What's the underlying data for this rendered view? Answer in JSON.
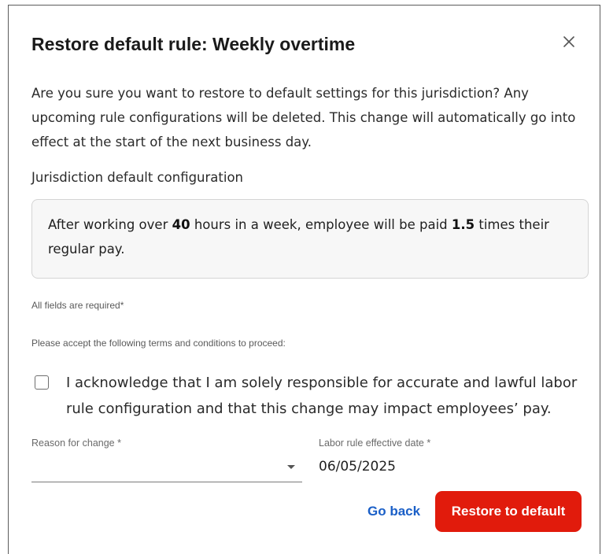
{
  "dialog": {
    "title": "Restore default rule: Weekly overtime",
    "close_icon": "close-icon",
    "intro": "Are you sure you want to restore to default settings for this jurisdiction? Any upcoming rule configurations will be deleted. This change will automatically go into effect at the start of the next business day.",
    "section_label": "Jurisdiction default configuration",
    "config": {
      "text_before_hours": "After working over ",
      "hours": "40",
      "text_after_hours": " hours in a week, employee will be paid ",
      "multiplier": "1.5",
      "text_after_multiplier": " times their regular pay."
    },
    "required_note": "All fields are required*",
    "terms_note": "Please accept the following terms and conditions to proceed:",
    "acknowledgement": {
      "checked": false,
      "text": "I acknowledge that I am solely responsible for accurate and lawful labor rule configuration and that this change may impact employees’ pay."
    },
    "reason_field": {
      "label": "Reason for change *",
      "value": "",
      "caret_icon": "caret-down-icon"
    },
    "date_field": {
      "label": "Labor rule effective date *",
      "value": "06/05/2025"
    },
    "actions": {
      "go_back": "Go back",
      "restore": "Restore to default"
    },
    "colors": {
      "primary_button": "#e11b0c",
      "link": "#1a5fc7"
    }
  }
}
